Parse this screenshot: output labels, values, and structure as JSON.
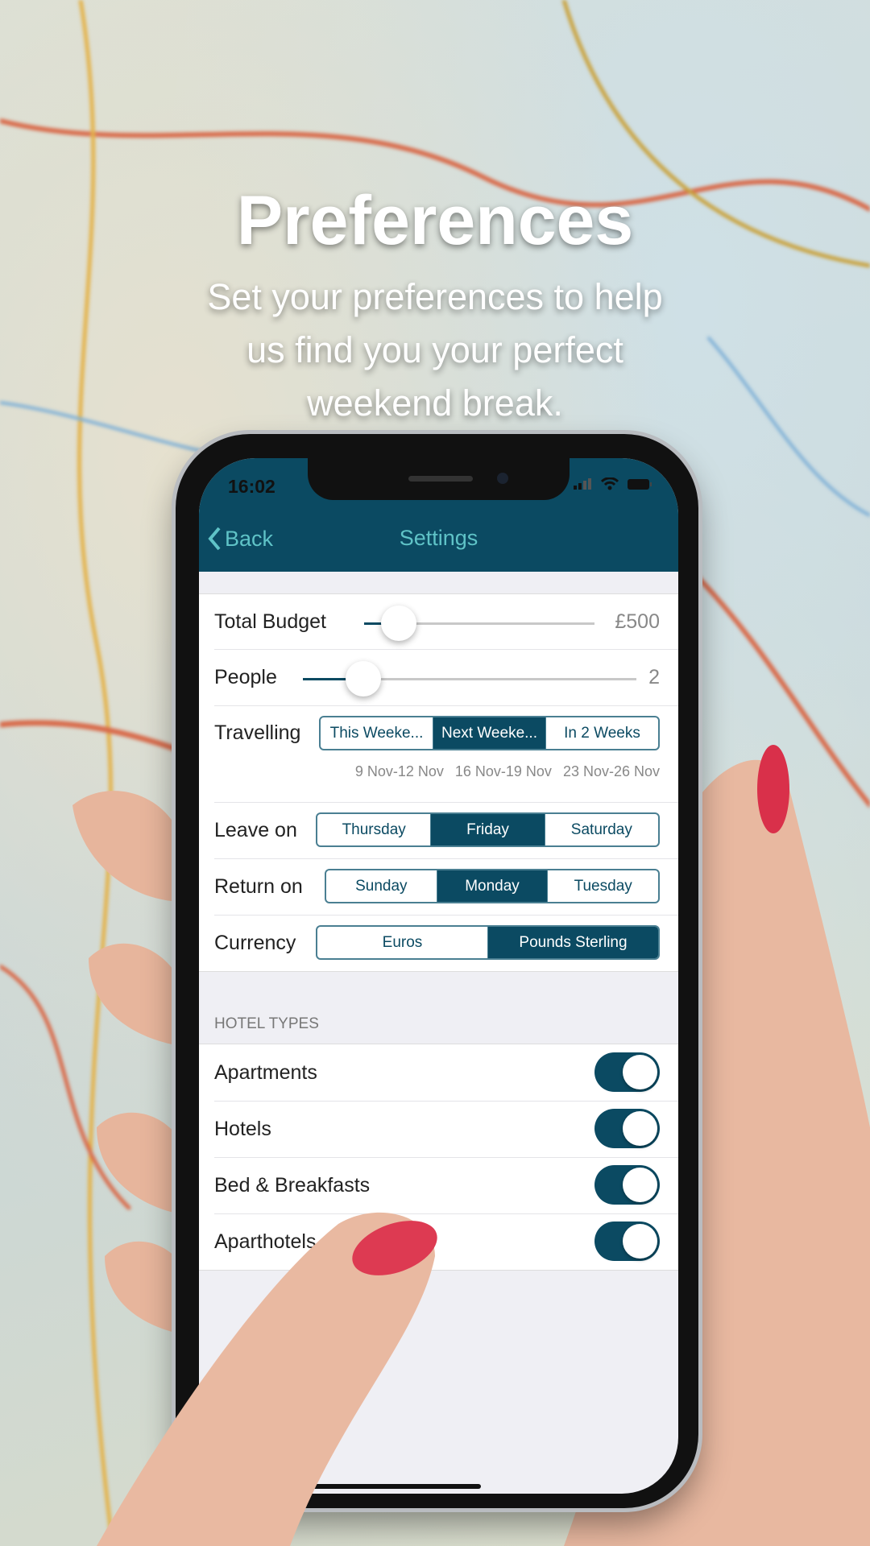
{
  "hero": {
    "title": "Preferences",
    "subtitle_lines": [
      "Set your preferences to help",
      "us find you your perfect",
      "weekend break."
    ]
  },
  "status_bar": {
    "time": "16:02"
  },
  "nav": {
    "back_label": "Back",
    "title": "Settings"
  },
  "settings": {
    "budget": {
      "label": "Total Budget",
      "value": "£500",
      "slider_fraction": 0.15
    },
    "people": {
      "label": "People",
      "value": "2",
      "slider_fraction": 0.18
    },
    "travelling": {
      "label": "Travelling",
      "options": [
        "This Weeke...",
        "Next Weeke...",
        "In 2 Weeks"
      ],
      "dates": [
        "9 Nov-12 Nov",
        "16 Nov-19 Nov",
        "23 Nov-26 Nov"
      ],
      "selected": 1
    },
    "leave_on": {
      "label": "Leave on",
      "options": [
        "Thursday",
        "Friday",
        "Saturday"
      ],
      "selected": 1
    },
    "return_on": {
      "label": "Return on",
      "options": [
        "Sunday",
        "Monday",
        "Tuesday"
      ],
      "selected": 1
    },
    "currency": {
      "label": "Currency",
      "options": [
        "Euros",
        "Pounds Sterling"
      ],
      "selected": 1
    }
  },
  "hotel_types": {
    "header": "HOTEL TYPES",
    "items": [
      {
        "label": "Apartments",
        "enabled": true
      },
      {
        "label": "Hotels",
        "enabled": true
      },
      {
        "label": "Bed & Breakfasts",
        "enabled": true
      },
      {
        "label": "Aparthotels",
        "enabled": true
      }
    ]
  },
  "colors": {
    "brand": "#0b4a62",
    "accent": "#5fc3c7"
  }
}
